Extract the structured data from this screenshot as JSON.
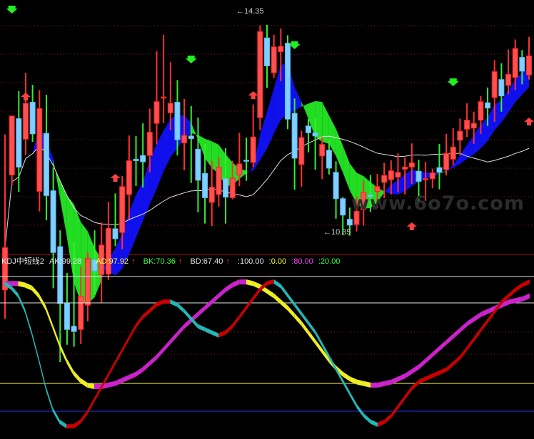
{
  "chart_data": [
    {
      "type": "candlestick",
      "title": "",
      "annotations": {
        "high": "14.35",
        "low": "10.35"
      },
      "candles": [
        [
          0,
          9.3,
          10.1,
          12.25,
          8.75
        ],
        [
          1,
          11.48,
          12.6,
          11.71,
          11.28
        ],
        [
          2,
          12.55,
          11.63,
          13.07,
          11.16
        ],
        [
          3,
          12.16,
          12.84,
          13.42,
          11.86
        ],
        [
          4,
          12.86,
          12.26,
          13.19,
          12.11
        ],
        [
          5,
          11.17,
          12.74,
          13.09,
          10.79
        ],
        [
          6,
          12.27,
          11.09,
          13.0,
          10.62
        ],
        [
          7,
          11.18,
          10.01,
          11.62,
          9.33
        ],
        [
          8,
          10.12,
          9.04,
          10.43,
          7.93
        ],
        [
          9,
          9.04,
          8.55,
          9.62,
          8.26
        ],
        [
          10,
          8.61,
          8.51,
          10.2,
          8.22
        ],
        [
          11,
          8.55,
          9.18,
          9.74,
          8.27
        ],
        [
          12,
          9.01,
          9.9,
          10.02,
          8.7
        ],
        [
          13,
          9.87,
          9.66,
          10.43,
          9.21
        ],
        [
          14,
          9.59,
          10.15,
          10.58,
          9.05
        ],
        [
          15,
          9.6,
          10.47,
          10.97,
          9.49
        ],
        [
          16,
          10.46,
          10.27,
          11.13,
          10.13
        ],
        [
          17,
          10.39,
          11.26,
          11.46,
          10.07
        ],
        [
          18,
          11.11,
          11.75,
          12.23,
          10.64
        ],
        [
          19,
          11.78,
          11.75,
          12.22,
          11.27
        ],
        [
          20,
          11.85,
          11.73,
          12.46,
          11.24
        ],
        [
          21,
          11.85,
          12.29,
          12.74,
          11.53
        ],
        [
          22,
          12.46,
          12.87,
          13.83,
          12.06
        ],
        [
          23,
          12.96,
          12.96,
          14.14,
          12.47
        ],
        [
          24,
          12.66,
          12.84,
          13.62,
          12.33
        ],
        [
          25,
          12.86,
          12.15,
          13.28,
          11.85
        ],
        [
          26,
          12.09,
          12.23,
          12.92,
          11.57
        ],
        [
          27,
          12.22,
          12.17,
          12.79,
          11.33
        ],
        [
          28,
          11.97,
          11.38,
          12.57,
          10.77
        ],
        [
          29,
          11.51,
          11.05,
          12.07,
          10.56
        ],
        [
          30,
          10.96,
          11.25,
          11.75,
          10.51
        ],
        [
          31,
          11.11,
          11.63,
          11.82,
          10.88
        ],
        [
          32,
          11.41,
          11.06,
          11.99,
          10.56
        ],
        [
          33,
          11.05,
          11.42,
          11.75,
          11.02
        ],
        [
          34,
          11.48,
          11.69,
          12.28,
          11.27
        ],
        [
          35,
          11.76,
          11.75,
          12.19,
          11.37
        ],
        [
          36,
          11.72,
          12.2,
          12.82,
          11.63
        ],
        [
          37,
          12.57,
          14.2,
          14.32,
          12.33
        ],
        [
          38,
          14.08,
          13.55,
          14.33,
          13.13
        ],
        [
          39,
          13.42,
          13.91,
          14.14,
          13.32
        ],
        [
          40,
          13.82,
          13.92,
          14.26,
          13.26
        ],
        [
          41,
          13.98,
          12.54,
          14.13,
          12.35
        ],
        [
          42,
          12.65,
          11.8,
          12.93,
          11.2
        ],
        [
          43,
          11.68,
          12.19,
          12.32,
          11.26
        ],
        [
          44,
          12.41,
          12.28,
          12.54,
          11.91
        ],
        [
          45,
          12.28,
          12.22,
          12.57,
          11.58
        ],
        [
          46,
          11.84,
          12.06,
          12.2,
          11.4
        ],
        [
          47,
          11.95,
          11.61,
          12.14,
          11.49
        ],
        [
          48,
          11.53,
          11.03,
          11.74,
          10.65
        ],
        [
          49,
          11.03,
          10.72,
          11.06,
          10.34
        ],
        [
          50,
          10.64,
          10.53,
          10.86,
          10.33
        ],
        [
          51,
          10.54,
          10.79,
          11.07,
          10.41
        ],
        [
          52,
          10.82,
          11.15,
          11.37,
          10.52
        ],
        [
          53,
          11.1,
          11.07,
          11.48,
          10.78
        ],
        [
          54,
          11.17,
          11.26,
          11.5,
          10.85
        ],
        [
          55,
          11.34,
          11.47,
          11.71,
          11.04
        ],
        [
          56,
          11.39,
          11.56,
          11.76,
          11.11
        ],
        [
          57,
          11.44,
          11.53,
          11.89,
          11.15
        ],
        [
          58,
          11.59,
          11.63,
          11.81,
          11.11
        ],
        [
          59,
          11.63,
          11.71,
          12.08,
          11.31
        ],
        [
          60,
          11.55,
          11.36,
          11.77,
          10.99
        ],
        [
          61,
          11.41,
          11.41,
          11.73,
          10.99
        ],
        [
          62,
          11.41,
          11.52,
          11.6,
          11.23
        ],
        [
          63,
          11.62,
          11.53,
          12.07,
          11.21
        ],
        [
          64,
          11.58,
          11.89,
          12.26,
          11.47
        ],
        [
          65,
          11.78,
          12.01,
          12.37,
          11.66
        ],
        [
          66,
          12.14,
          12.31,
          12.55,
          11.85
        ],
        [
          67,
          12.35,
          12.52,
          12.84,
          12.2
        ],
        [
          68,
          12.37,
          12.46,
          12.68,
          12.07
        ],
        [
          69,
          12.52,
          12.87,
          12.98,
          12.26
        ],
        [
          70,
          12.85,
          12.75,
          13.14,
          12.41
        ],
        [
          71,
          12.95,
          13.44,
          13.66,
          12.49
        ],
        [
          72,
          13.29,
          12.98,
          13.6,
          12.68
        ],
        [
          73,
          13.18,
          13.39,
          13.86,
          13.01
        ],
        [
          74,
          13.33,
          13.88,
          14.05,
          13.09
        ],
        [
          75,
          13.71,
          13.45,
          13.85,
          13.2
        ],
        [
          76,
          13.38,
          13.74,
          14.1,
          13.29
        ]
      ],
      "ylim": [
        10.0,
        14.8
      ]
    },
    {
      "type": "line",
      "title": "KDJ中短线2",
      "legend": [
        {
          "label": "AK:99.28",
          "arrow": "↑",
          "color": "#e8e8e8"
        },
        {
          "label": "AD:97.92",
          "arrow": "↑",
          "color": "#ffff44"
        },
        {
          "label": "BK:70.36",
          "arrow": "↑",
          "color": "#44ff44"
        },
        {
          "label": "BD:67.40",
          "arrow": "↑",
          "color": "#e8e8e8"
        },
        {
          "label": ":100.00",
          "arrow": "",
          "color": "#e8e8e8"
        },
        {
          "label": ":0.00",
          "arrow": "",
          "color": "#ffff44"
        },
        {
          "label": ":80.00",
          "arrow": "",
          "color": "#ff44ff"
        },
        {
          "label": ":20.00",
          "arrow": "",
          "color": "#44ff44"
        }
      ],
      "ylim": [
        0,
        100
      ],
      "levels": [
        100,
        80,
        20,
        0
      ],
      "series": [
        {
          "values": [
            98,
            98,
            98,
            97,
            95,
            90,
            82,
            70,
            58,
            48,
            40,
            35,
            32,
            31,
            31,
            32,
            33,
            35,
            37,
            39,
            42,
            46,
            50,
            55,
            60,
            65,
            70,
            74,
            78,
            82,
            86,
            90,
            94,
            97,
            99,
            99,
            98,
            96,
            93,
            90,
            86,
            82,
            77,
            72,
            66,
            60,
            54,
            48,
            43,
            39,
            36,
            34,
            33,
            32,
            32,
            33,
            34,
            36,
            38,
            41,
            44,
            48,
            52,
            56,
            60,
            64,
            68,
            72,
            75,
            78,
            80,
            82,
            84,
            86,
            87,
            88,
            90
          ]
        },
        {
          "values": [
            98,
            95,
            90,
            80,
            65,
            48,
            30,
            16,
            8,
            5,
            5,
            8,
            14,
            22,
            30,
            38,
            46,
            54,
            62,
            70,
            76,
            80,
            84,
            86,
            86,
            84,
            80,
            75,
            70,
            68,
            66,
            64,
            66,
            70,
            76,
            82,
            88,
            94,
            98,
            99,
            96,
            90,
            84,
            78,
            72,
            66,
            58,
            50,
            42,
            34,
            26,
            18,
            12,
            8,
            6,
            8,
            12,
            18,
            24,
            30,
            34,
            36,
            38,
            40,
            42,
            46,
            50,
            56,
            62,
            68,
            74,
            80,
            86,
            90,
            94,
            97,
            99
          ]
        }
      ]
    }
  ]
}
